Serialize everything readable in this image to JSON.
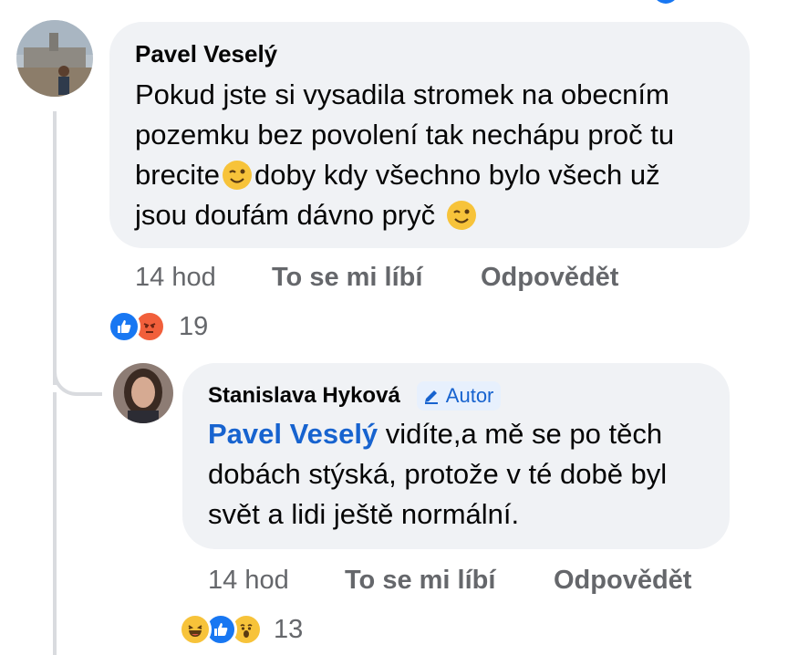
{
  "comments": [
    {
      "author": "Pavel Veselý",
      "lines": [
        "Pokud jste si vysadila stromek  na obecním",
        "pozemku bez povolení tak nechápu proč tu",
        "brecite",
        "doby kdy všechno bylo všech už",
        "jsou doufám dávno pryč"
      ],
      "time": "14 hod",
      "like_label": "To se mi líbí",
      "reply_label": "Odpovědět",
      "reaction_count": "19",
      "reaction_icons": [
        "like-icon",
        "angry-icon"
      ]
    },
    {
      "author": "Stanislava Hyková",
      "author_badge": "Autor",
      "mention": "Pavel Veselý",
      "lines": [
        " vidíte,a mě se po těch",
        "dobách stýská, protože v té době byl",
        "svět a lidi ještě normální."
      ],
      "time": "14 hod",
      "like_label": "To se mi líbí",
      "reply_label": "Odpovědět",
      "reaction_count": "13",
      "reaction_icons": [
        "haha-icon",
        "like-icon",
        "wow-icon"
      ]
    }
  ],
  "colors": {
    "bubble": "#f0f2f5",
    "link": "#1763cf",
    "muted": "#65676b",
    "like": "#1877f2",
    "angry": "#f15f3b"
  }
}
